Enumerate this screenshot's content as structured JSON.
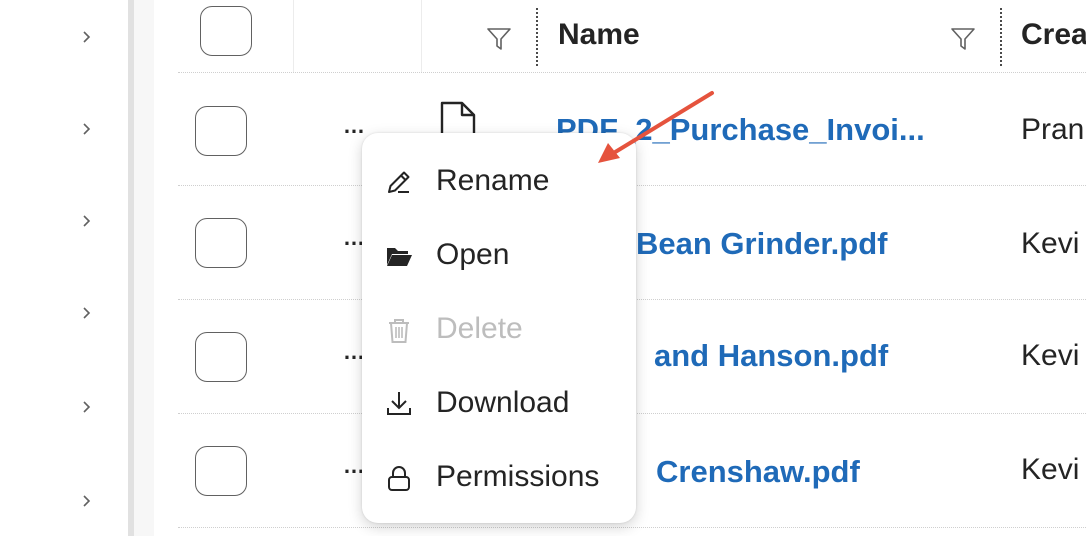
{
  "header": {
    "name_label": "Name",
    "created_label": "Crea"
  },
  "rows": [
    {
      "name": "PDF_2_Purchase_Invoi...",
      "creator": "Pran"
    },
    {
      "name": "Bean Grinder.pdf",
      "creator": "Kevi"
    },
    {
      "name": "and Hanson.pdf",
      "creator": "Kevi"
    },
    {
      "name": "Crenshaw.pdf",
      "creator": "Kevi"
    }
  ],
  "row_more_label": "…",
  "context_menu": {
    "items": [
      {
        "label": "Rename",
        "icon": "edit-icon",
        "disabled": false
      },
      {
        "label": "Open",
        "icon": "folder-open-icon",
        "disabled": false
      },
      {
        "label": "Delete",
        "icon": "trash-icon",
        "disabled": true
      },
      {
        "label": "Download",
        "icon": "download-icon",
        "disabled": false
      },
      {
        "label": "Permissions",
        "icon": "lock-icon",
        "disabled": false
      }
    ]
  },
  "colors": {
    "link": "#1f6ab8",
    "annotation_arrow": "#e5533d",
    "disabled": "#bdbdbd"
  }
}
